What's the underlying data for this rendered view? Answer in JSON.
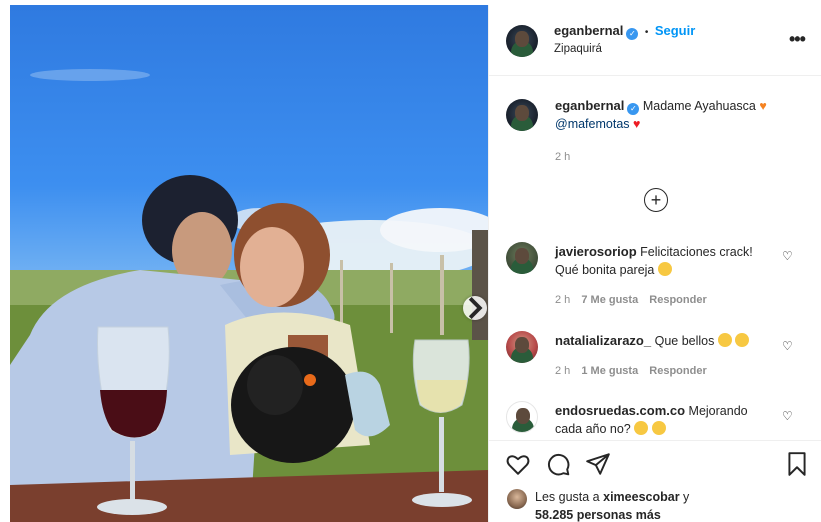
{
  "post": {
    "author": "eganbernal",
    "follow_label": "Seguir",
    "separator": "•",
    "location": "Zipaquirá",
    "more_label": "•••"
  },
  "caption": {
    "author": "eganbernal",
    "text": "Madame Ayahuasca",
    "mention": "@mafemotas",
    "time": "2 h",
    "load_more_label": "+"
  },
  "comments": [
    {
      "author": "javierosoriop",
      "text_line1": "Felicitaciones crack!",
      "text_line2": "Qué bonita pareja",
      "time": "2 h",
      "likes": "7 Me gusta",
      "reply": "Responder"
    },
    {
      "author": "natalializarazo_",
      "text_line1": "Que bellos",
      "time": "2 h",
      "likes": "1 Me gusta",
      "reply": "Responder"
    },
    {
      "author": "endosruedas.com.co",
      "text_line1": "Mejorando",
      "text_line2": "cada año no?"
    }
  ],
  "likes": {
    "prefix": "Les gusta a",
    "user": "ximeescobar",
    "suffix": "y",
    "count": "58.285 personas más"
  },
  "icons": {
    "verified": "verified-badge-icon",
    "heart": "heart-icon",
    "comment": "comment-icon",
    "share": "share-icon",
    "save": "bookmark-icon",
    "next": "chevron-right-icon"
  },
  "colors": {
    "link": "#0095f6",
    "verified": "#3897f0",
    "meta": "#8e8e8e",
    "heart_orange": "#f58220",
    "heart_red": "#ed1c24"
  }
}
